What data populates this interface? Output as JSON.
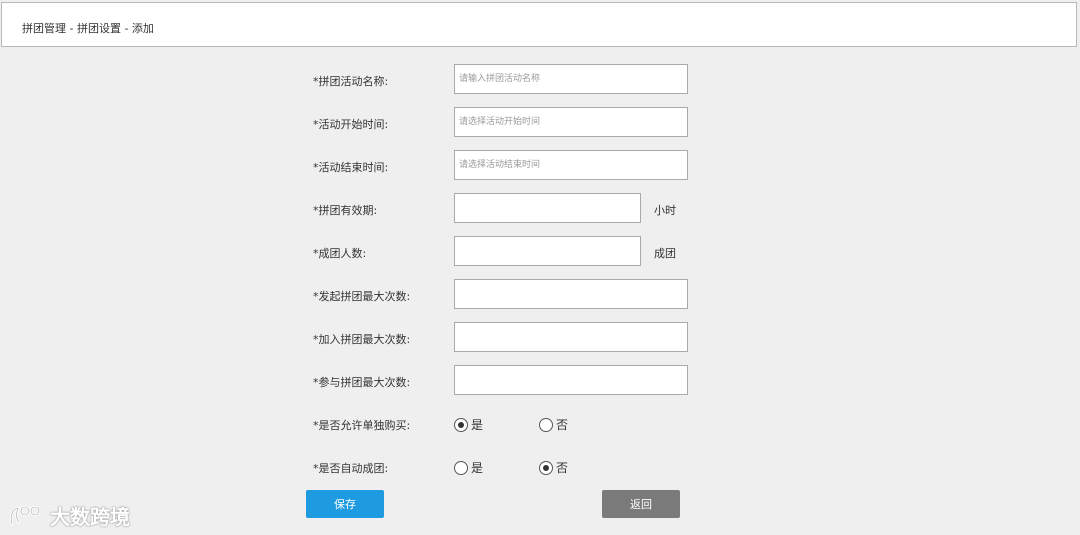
{
  "breadcrumb": "拼团管理 - 拼团设置 -  添加",
  "form": {
    "activity_name": {
      "label": "*拼团活动名称:",
      "placeholder": "请输入拼团活动名称",
      "value": ""
    },
    "start_time": {
      "label": "*活动开始时间:",
      "placeholder": "请选择活动开始时间",
      "value": ""
    },
    "end_time": {
      "label": "*活动结束时间:",
      "placeholder": "请选择活动结束时间",
      "value": ""
    },
    "validity": {
      "label": "*拼团有效期:",
      "unit": "小时",
      "value": ""
    },
    "group_size": {
      "label": "*成团人数:",
      "unit": "成团",
      "value": ""
    },
    "max_initiate": {
      "label": "*发起拼团最大次数:",
      "value": ""
    },
    "max_join": {
      "label": "*加入拼团最大次数:",
      "value": ""
    },
    "max_participate": {
      "label": "*参与拼团最大次数:",
      "value": ""
    },
    "allow_single": {
      "label": "*是否允许单独购买:",
      "yes": "是",
      "no": "否",
      "selected": "是"
    },
    "auto_group": {
      "label": "*是否自动成团:",
      "yes": "是",
      "no": "否",
      "selected": "否"
    }
  },
  "buttons": {
    "save": "保存",
    "back": "返回"
  },
  "watermark": {
    "text": "大数跨境",
    "icon": "brand-logo-icon"
  },
  "colors": {
    "save_button": "#1e9be0",
    "back_button": "#7a7a7a",
    "background": "#efefef"
  }
}
